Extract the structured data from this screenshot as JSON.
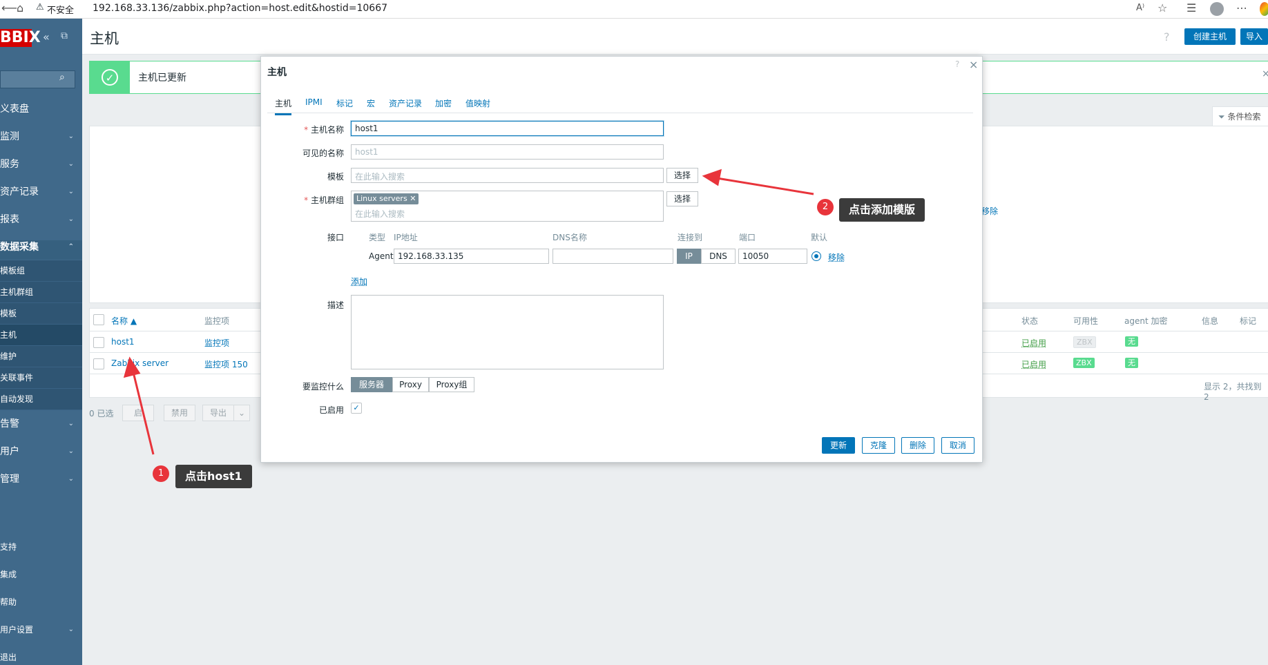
{
  "browser": {
    "insecure_label": "不安全",
    "url": "192.168.33.136/zabbix.php?action=host.edit&hostid=10667"
  },
  "sidebar": {
    "logo": "BBIX",
    "items": [
      {
        "label": "义表盘",
        "chevron": false
      },
      {
        "label": "监测",
        "chevron": true
      },
      {
        "label": "服务",
        "chevron": true
      },
      {
        "label": "资产记录",
        "chevron": true
      },
      {
        "label": "报表",
        "chevron": true
      },
      {
        "label": "数据采集",
        "chevron": true
      }
    ],
    "subitems": [
      "模板组",
      "主机群组",
      "模板",
      "主机",
      "维护",
      "关联事件",
      "自动发现"
    ],
    "items2": [
      {
        "label": "告警",
        "chevron": true
      },
      {
        "label": "用户",
        "chevron": true
      },
      {
        "label": "管理",
        "chevron": true
      }
    ],
    "bottom": [
      {
        "label": "支持",
        "chevron": false
      },
      {
        "label": "集成",
        "chevron": false
      },
      {
        "label": "帮助",
        "chevron": false
      },
      {
        "label": "用户设置",
        "chevron": true
      },
      {
        "label": "退出",
        "chevron": false
      }
    ]
  },
  "header": {
    "title": "主机",
    "help": "?",
    "create_host": "创建主机",
    "import": "导入"
  },
  "banner": {
    "message": "主机已更新",
    "close": "×"
  },
  "filter": {
    "tab_label": "条件检索",
    "remove_link": "移除"
  },
  "table": {
    "headers": [
      "名称 ▲",
      "监控项",
      "状态",
      "可用性",
      "agent 加密",
      "信息",
      "标记"
    ],
    "rows": [
      {
        "name": "host1",
        "items": "监控项",
        "status": "已启用",
        "zbx": "ZBX",
        "zbx_active": false,
        "enc": "无"
      },
      {
        "name": "Zabbix server",
        "items": "监控项 150",
        "status": "已启用",
        "zbx": "ZBX",
        "zbx_active": true,
        "enc": "无"
      }
    ],
    "summary": "显示 2，共找到 2",
    "selected": "0 已选",
    "buttons": [
      "启",
      "禁用",
      "导出"
    ]
  },
  "modal": {
    "title": "主机",
    "help": "?",
    "close": "×",
    "tabs": [
      "主机",
      "IPMI",
      "标记",
      "宏",
      "资产记录",
      "加密",
      "值映射"
    ],
    "fields": {
      "hostname_label": "主机名称",
      "hostname_value": "host1",
      "visible_label": "可见的名称",
      "visible_placeholder": "host1",
      "templates_label": "模板",
      "templates_placeholder": "在此输入搜索",
      "select_label": "选择",
      "groups_label": "主机群组",
      "group_chip": "Linux servers",
      "groups_placeholder": "在此输入搜索",
      "interfaces_label": "接口",
      "iface_headers": [
        "类型",
        "IP地址",
        "DNS名称",
        "连接到",
        "端口",
        "默认"
      ],
      "iface_type": "Agent",
      "iface_ip": "192.168.33.135",
      "iface_dns": "",
      "conn_ip": "IP",
      "conn_dns": "DNS",
      "iface_port": "10050",
      "iface_remove": "移除",
      "add_link": "添加",
      "desc_label": "描述",
      "monitored_label": "要监控什么",
      "monitored_options": [
        "服务器",
        "Proxy",
        "Proxy组"
      ],
      "enabled_label": "已启用"
    },
    "buttons": {
      "update": "更新",
      "clone": "克隆",
      "delete": "删除",
      "cancel": "取消"
    }
  },
  "annotations": {
    "one_num": "1",
    "one_text": "点击host1",
    "two_num": "2",
    "two_text": "点击添加模版",
    "color": "#e8343b"
  },
  "colors": {
    "sidebar": "#40698a",
    "accent": "#0275b8",
    "success": "#59db8f"
  }
}
